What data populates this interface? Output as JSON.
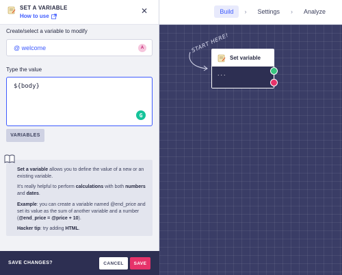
{
  "nav": {
    "build": "Build",
    "settings": "Settings",
    "analyze": "Analyze",
    "separator": "›"
  },
  "panel": {
    "title": "SET A VARIABLE",
    "how_to_use": "How to use",
    "close": "✕",
    "variable_label": "Create/select a variable to modify",
    "variable_value": "@ welcome",
    "variable_badge": "A",
    "value_label": "Type the value",
    "value_text": "${body}",
    "grammarly_badge": "G",
    "variables_button": "VARIABLES"
  },
  "help": {
    "p1_bold": "Set a variable",
    "p1_rest": " allows you to define the value of a new or an existing variable.",
    "p2_pre": "It's really helpful to perform ",
    "p2_bold1": "calculations",
    "p2_mid": " with both ",
    "p2_bold2": "numbers",
    "p2_and": " and ",
    "p2_bold3": "dates",
    "p2_end": ".",
    "p3_bold": "Example",
    "p3_pre": ": you can create a variable named @end_price and set its value as the sum of another variable and a number (",
    "p3_code": "@end_price = @price + 10",
    "p3_end": ").",
    "p4_bold": "Hacker tip",
    "p4_pre": ": try adding ",
    "p4_code": "HTML",
    "p4_end": "."
  },
  "footer": {
    "save_changes": "SAVE CHANGES?",
    "cancel": "CANCEL",
    "save": "SAVE"
  },
  "canvas": {
    "start_here": "START HERE!",
    "node_title": "Set variable",
    "node_body": "..."
  },
  "colors": {
    "accent": "#3d5afe",
    "canvas": "#3a3d66",
    "save": "#e6336a",
    "port_green": "#37c47e",
    "port_red": "#e6336a"
  }
}
